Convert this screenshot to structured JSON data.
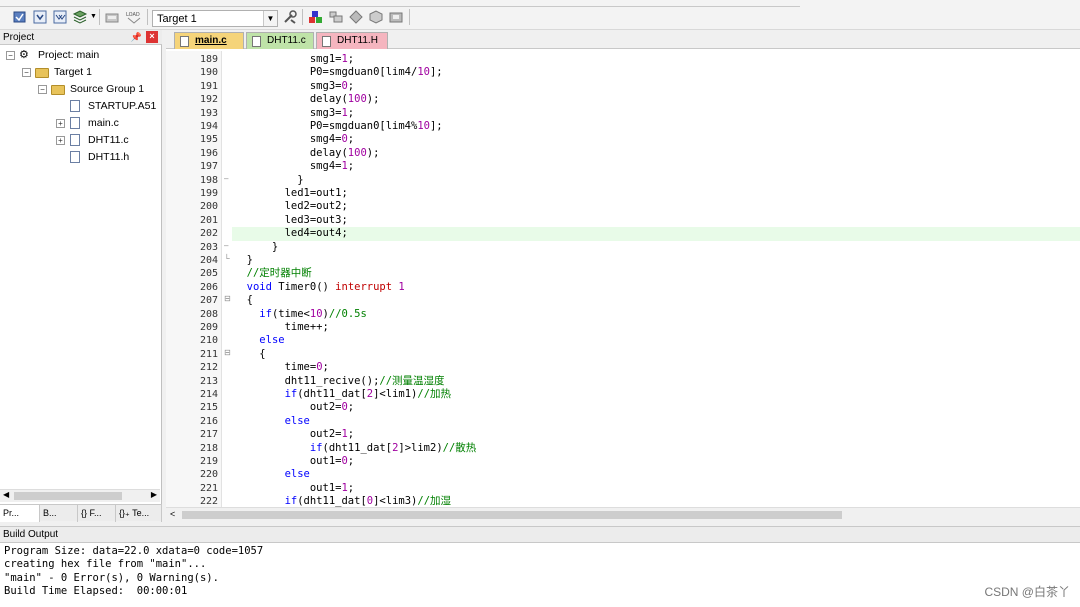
{
  "toolbar": {
    "target_value": "Target 1",
    "icons": [
      "translate-icon",
      "build-icon",
      "rebuild-icon",
      "batch-build-icon",
      "download-icon",
      "target-options-icon",
      "manage-components-icon",
      "select-packs-icon",
      "pack-installer-icon",
      "rte-icon",
      "wizard-icon"
    ]
  },
  "project": {
    "header": "Project",
    "tree": {
      "root": "Project: main",
      "target": "Target 1",
      "group": "Source Group 1",
      "files": [
        "STARTUP.A51",
        "main.c",
        "DHT11.c",
        "DHT11.h"
      ]
    },
    "tabs": [
      "Pr...",
      "B...",
      "{} F...",
      "{}₊ Te..."
    ]
  },
  "editor": {
    "tabs": [
      {
        "label": "main.c",
        "color": "#f5d47a",
        "active": true
      },
      {
        "label": "DHT11.c",
        "color": "#bfe3a8",
        "active": false
      },
      {
        "label": "DHT11.H",
        "color": "#f5b5bf",
        "active": false
      }
    ],
    "highlighted_line": 202,
    "lines": [
      {
        "n": "189",
        "f": "",
        "t": [
          [
            "            smg1=",
            ""
          ],
          [
            "1",
            "num"
          ],
          [
            ";",
            ""
          ]
        ]
      },
      {
        "n": "190",
        "f": "",
        "t": [
          [
            "            P0=smgduan0[lim4/",
            ""
          ],
          [
            "10",
            "num"
          ],
          [
            "];",
            ""
          ]
        ]
      },
      {
        "n": "191",
        "f": "",
        "t": [
          [
            "            smg3=",
            ""
          ],
          [
            "0",
            "num"
          ],
          [
            ";",
            ""
          ]
        ]
      },
      {
        "n": "192",
        "f": "",
        "t": [
          [
            "            delay(",
            ""
          ],
          [
            "100",
            "num"
          ],
          [
            ");",
            ""
          ]
        ]
      },
      {
        "n": "193",
        "f": "",
        "t": [
          [
            "            smg3=",
            ""
          ],
          [
            "1",
            "num"
          ],
          [
            ";",
            ""
          ]
        ]
      },
      {
        "n": "194",
        "f": "",
        "t": [
          [
            "            P0=smgduan0[lim4%",
            ""
          ],
          [
            "10",
            "num"
          ],
          [
            "];",
            ""
          ]
        ]
      },
      {
        "n": "195",
        "f": "",
        "t": [
          [
            "            smg4=",
            ""
          ],
          [
            "0",
            "num"
          ],
          [
            ";",
            ""
          ]
        ]
      },
      {
        "n": "196",
        "f": "",
        "t": [
          [
            "            delay(",
            ""
          ],
          [
            "100",
            "num"
          ],
          [
            ");",
            ""
          ]
        ]
      },
      {
        "n": "197",
        "f": "",
        "t": [
          [
            "            smg4=",
            ""
          ],
          [
            "1",
            "num"
          ],
          [
            ";",
            ""
          ]
        ]
      },
      {
        "n": "198",
        "f": "–",
        "t": [
          [
            "          }",
            ""
          ]
        ]
      },
      {
        "n": "199",
        "f": "",
        "t": [
          [
            "        led1=out1;",
            ""
          ]
        ]
      },
      {
        "n": "200",
        "f": "",
        "t": [
          [
            "        led2=out2;",
            ""
          ]
        ]
      },
      {
        "n": "201",
        "f": "",
        "t": [
          [
            "        led3=out3;",
            ""
          ]
        ]
      },
      {
        "n": "202",
        "f": "",
        "t": [
          [
            "        led4=out4;",
            ""
          ]
        ]
      },
      {
        "n": "203",
        "f": "–",
        "t": [
          [
            "      }",
            ""
          ]
        ]
      },
      {
        "n": "204",
        "f": "└",
        "t": [
          [
            "  }",
            ""
          ]
        ]
      },
      {
        "n": "205",
        "f": "",
        "t": [
          [
            "  //定时器中断",
            "cm"
          ]
        ]
      },
      {
        "n": "206",
        "f": "",
        "t": [
          [
            "  void ",
            "kw"
          ],
          [
            "Timer0() ",
            ""
          ],
          [
            "interrupt ",
            "red"
          ],
          [
            "1",
            "num"
          ]
        ]
      },
      {
        "n": "207",
        "f": "⊟",
        "t": [
          [
            "  {",
            ""
          ]
        ]
      },
      {
        "n": "208",
        "f": "",
        "t": [
          [
            "    ",
            ""
          ],
          [
            "if",
            "kw"
          ],
          [
            "(time<",
            ""
          ],
          [
            "10",
            "num"
          ],
          [
            ")",
            ""
          ],
          [
            "//0.5s",
            "cm"
          ]
        ]
      },
      {
        "n": "209",
        "f": "",
        "t": [
          [
            "        time++;",
            ""
          ]
        ]
      },
      {
        "n": "210",
        "f": "",
        "t": [
          [
            "    ",
            ""
          ],
          [
            "else",
            "kw"
          ]
        ]
      },
      {
        "n": "211",
        "f": "⊟",
        "t": [
          [
            "    {",
            ""
          ]
        ]
      },
      {
        "n": "212",
        "f": "",
        "t": [
          [
            "        time=",
            ""
          ],
          [
            "0",
            "num"
          ],
          [
            ";",
            ""
          ]
        ]
      },
      {
        "n": "213",
        "f": "",
        "t": [
          [
            "        dht11_recive();",
            ""
          ],
          [
            "//测量温湿度",
            "cm"
          ]
        ]
      },
      {
        "n": "214",
        "f": "",
        "t": [
          [
            "        ",
            ""
          ],
          [
            "if",
            "kw"
          ],
          [
            "(dht11_dat[",
            ""
          ],
          [
            "2",
            "num"
          ],
          [
            "]<lim1)",
            ""
          ],
          [
            "//加热",
            "cm"
          ]
        ]
      },
      {
        "n": "215",
        "f": "",
        "t": [
          [
            "            out2=",
            ""
          ],
          [
            "0",
            "num"
          ],
          [
            ";",
            ""
          ]
        ]
      },
      {
        "n": "216",
        "f": "",
        "t": [
          [
            "        ",
            ""
          ],
          [
            "else",
            "kw"
          ]
        ]
      },
      {
        "n": "217",
        "f": "",
        "t": [
          [
            "            out2=",
            ""
          ],
          [
            "1",
            "num"
          ],
          [
            ";",
            ""
          ]
        ]
      },
      {
        "n": "218",
        "f": "",
        "t": [
          [
            "            ",
            ""
          ],
          [
            "if",
            "kw"
          ],
          [
            "(dht11_dat[",
            ""
          ],
          [
            "2",
            "num"
          ],
          [
            "]>lim2)",
            ""
          ],
          [
            "//散热",
            "cm"
          ]
        ]
      },
      {
        "n": "219",
        "f": "",
        "t": [
          [
            "            out1=",
            ""
          ],
          [
            "0",
            "num"
          ],
          [
            ";",
            ""
          ]
        ]
      },
      {
        "n": "220",
        "f": "",
        "t": [
          [
            "        ",
            ""
          ],
          [
            "else",
            "kw"
          ]
        ]
      },
      {
        "n": "221",
        "f": "",
        "t": [
          [
            "            out1=",
            ""
          ],
          [
            "1",
            "num"
          ],
          [
            ";",
            ""
          ]
        ]
      },
      {
        "n": "222",
        "f": "",
        "t": [
          [
            "        ",
            ""
          ],
          [
            "if",
            "kw"
          ],
          [
            "(dht11_dat[",
            ""
          ],
          [
            "0",
            "num"
          ],
          [
            "]<lim3)",
            ""
          ],
          [
            "//加湿",
            "cm"
          ]
        ]
      }
    ]
  },
  "build": {
    "header": "Build Output",
    "lines": [
      "Program Size: data=22.0 xdata=0 code=1057",
      "creating hex file from \"main\"...",
      "\"main\" - 0 Error(s), 0 Warning(s).",
      "Build Time Elapsed:  00:00:01"
    ]
  },
  "watermark": "CSDN @白茶丫"
}
